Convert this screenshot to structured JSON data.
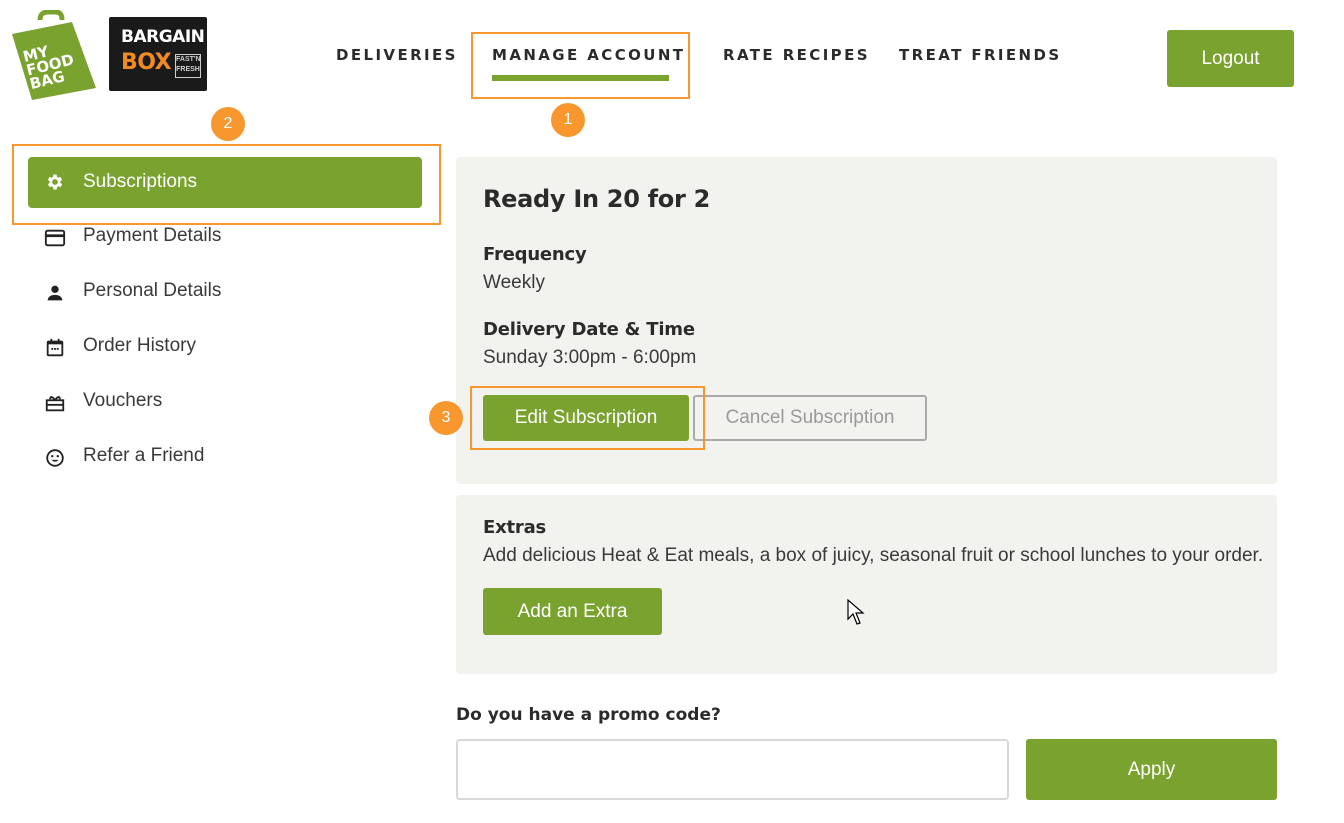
{
  "brand": {
    "logo_primary": {
      "line1": "MY",
      "line2": "FOOD",
      "line3": "BAG"
    },
    "logo_secondary": {
      "line1": "BARGAIN",
      "line2": "BOX",
      "tag1": "FAST'N",
      "tag2": "FRESH"
    },
    "accent_color": "#7aa22f",
    "annotation_color": "#f7972e"
  },
  "nav": {
    "items": [
      {
        "label": "DELIVERIES",
        "active": false
      },
      {
        "label": "MANAGE ACCOUNT",
        "active": true
      },
      {
        "label": "RATE RECIPES",
        "active": false
      },
      {
        "label": "TREAT FRIENDS",
        "active": false
      }
    ],
    "logout_label": "Logout"
  },
  "annotations": {
    "badge1": "1",
    "badge2": "2",
    "badge3": "3"
  },
  "sidebar": {
    "items": [
      {
        "label": "Subscriptions",
        "icon": "gear-icon",
        "active": true
      },
      {
        "label": "Payment Details",
        "icon": "credit-card-icon"
      },
      {
        "label": "Personal Details",
        "icon": "person-icon"
      },
      {
        "label": "Order History",
        "icon": "calendar-icon"
      },
      {
        "label": "Vouchers",
        "icon": "gift-icon"
      },
      {
        "label": "Refer a Friend",
        "icon": "smiley-icon"
      }
    ]
  },
  "subscription": {
    "title": "Ready In 20 for 2",
    "frequency_label": "Frequency",
    "frequency_value": "Weekly",
    "delivery_label": "Delivery Date & Time",
    "delivery_value": "Sunday 3:00pm - 6:00pm",
    "edit_label": "Edit Subscription",
    "cancel_label": "Cancel Subscription"
  },
  "extras": {
    "title": "Extras",
    "description": "Add delicious Heat & Eat meals, a box of juicy, seasonal fruit or school lunches to your order.",
    "button_label": "Add an Extra"
  },
  "promo": {
    "label": "Do you have a promo code?",
    "value": "",
    "placeholder": "",
    "apply_label": "Apply"
  }
}
